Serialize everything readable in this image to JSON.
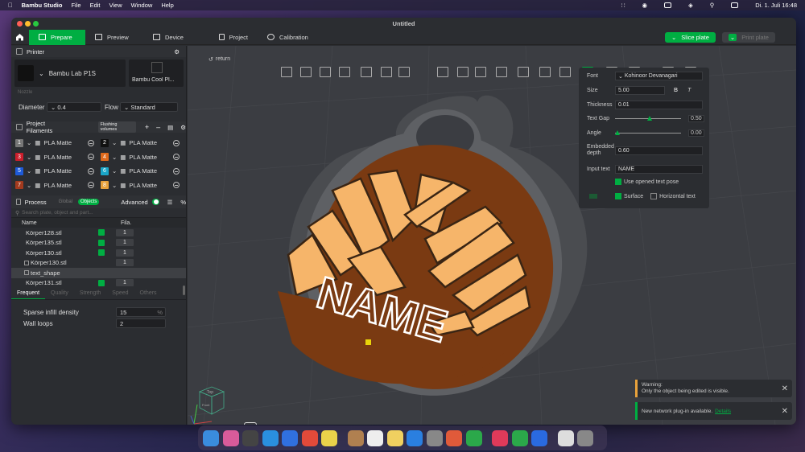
{
  "menubar": {
    "apple": "",
    "app": "Bambu Studio",
    "items": [
      "File",
      "Edit",
      "View",
      "Window",
      "Help"
    ],
    "clock": "Di. 1. Juli  16:48"
  },
  "window": {
    "title": "Untitled"
  },
  "tabs": [
    {
      "label": "Prepare"
    },
    {
      "label": "Preview"
    },
    {
      "label": "Device"
    },
    {
      "label": "Project"
    },
    {
      "label": "Calibration"
    }
  ],
  "actions": {
    "slice": "Slice plate",
    "print": "Print plate"
  },
  "printer": {
    "section": "Printer",
    "model": "Bambu Lab P1S",
    "plate": "Bambu Cool Pl...",
    "nozzle_label": "Nozzle",
    "diameter_label": "Diameter",
    "diameter": "0.4",
    "flow_label": "Flow",
    "flow": "Standard"
  },
  "filaments": {
    "section": "Project Filaments",
    "flush": "Flushing volumes",
    "items": [
      {
        "n": "1",
        "name": "PLA Matte",
        "color": "#777777"
      },
      {
        "n": "2",
        "name": "PLA Matte",
        "color": "#111111"
      },
      {
        "n": "3",
        "name": "PLA Matte",
        "color": "#cc1e2c"
      },
      {
        "n": "4",
        "name": "PLA Matte",
        "color": "#e06a1c"
      },
      {
        "n": "5",
        "name": "PLA Matte",
        "color": "#1e5ad8"
      },
      {
        "n": "6",
        "name": "PLA Matte",
        "color": "#1aa6c8"
      },
      {
        "n": "7",
        "name": "PLA Matte",
        "color": "#a23a1e"
      },
      {
        "n": "8",
        "name": "PLA Matte",
        "color": "#e8a23c"
      }
    ]
  },
  "process": {
    "section": "Process",
    "global": "Global",
    "objects": "Objects",
    "advanced": "Advanced",
    "search_placeholder": "Search plate, object and part...",
    "col_name": "Name",
    "col_fila": "Fila.",
    "rows": [
      {
        "name": "Körper128.stl",
        "fila": "1",
        "indent": 0,
        "checked": true
      },
      {
        "name": "Körper135.stl",
        "fila": "1",
        "indent": 0,
        "checked": true
      },
      {
        "name": "Körper130.stl",
        "fila": "1",
        "indent": 0,
        "checked": true
      },
      {
        "name": "Körper130.stl",
        "fila": "1",
        "indent": 1,
        "checked": false
      },
      {
        "name": "text_shape",
        "fila": "",
        "indent": 1,
        "checked": false
      },
      {
        "name": "Körper131.stl",
        "fila": "1",
        "indent": 0,
        "checked": true
      }
    ],
    "subtabs": [
      "Frequent",
      "Quality",
      "Strength",
      "Speed",
      "Others"
    ],
    "params": [
      {
        "label": "Sparse infill density",
        "value": "15",
        "unit": "%"
      },
      {
        "label": "Wall loops",
        "value": "2",
        "unit": ""
      }
    ]
  },
  "viewport": {
    "return": "return",
    "cube_top": "Top",
    "cube_front": "Front"
  },
  "text_panel": {
    "font_label": "Font",
    "font": "Kohinoor Devanagari",
    "size_label": "Size",
    "size": "5.00",
    "bold": "B",
    "italic": "T",
    "thickness_label": "Thickness",
    "thickness": "0.01",
    "gap_label": "Text Gap",
    "gap": "0.50",
    "angle_label": "Angle",
    "angle": "0.00",
    "embed_label": "Embedded depth",
    "embed": "0.60",
    "input_label": "Input text",
    "input": "NAME",
    "use_pose": "Use opened text pose",
    "surface": "Surface",
    "horizontal": "Horizontal text"
  },
  "model_text": "NAME",
  "notifications": [
    {
      "title": "Warning:",
      "body": "Only the object being edited is visible.",
      "link": ""
    },
    {
      "title": "",
      "body": "New network plug-in available.",
      "link": "Details"
    }
  ],
  "colors": {
    "accent": "#00ae42",
    "wood_light": "#f6b56a",
    "wood_dark": "#7a3a12",
    "tag_grey": "#5e6064"
  }
}
